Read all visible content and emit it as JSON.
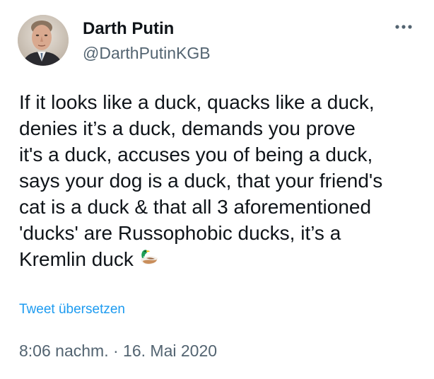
{
  "tweet": {
    "author": {
      "display_name": "Darth Putin",
      "handle": "@DarthPutinKGB"
    },
    "text_body": "If it looks like a duck, quacks like a duck,\ndenies it’s a duck, demands you prove\nit's a duck, accuses you of being a duck,\nsays your dog is a duck, that your friend's\ncat is a duck & that all 3 aforementioned\n'ducks' are Russophobic ducks, it’s a\nKremlin duck",
    "emoji": "duck-emoji",
    "translate_label": "Tweet übersetzen",
    "time": "8:06 nachm.",
    "separator": "·",
    "date": "16. Mai 2020"
  },
  "colors": {
    "text": "#0f1419",
    "secondary": "#536471",
    "link": "#1d9bf0"
  },
  "icons": {
    "more": "more-horizontal-icon",
    "avatar": "avatar-portrait"
  }
}
